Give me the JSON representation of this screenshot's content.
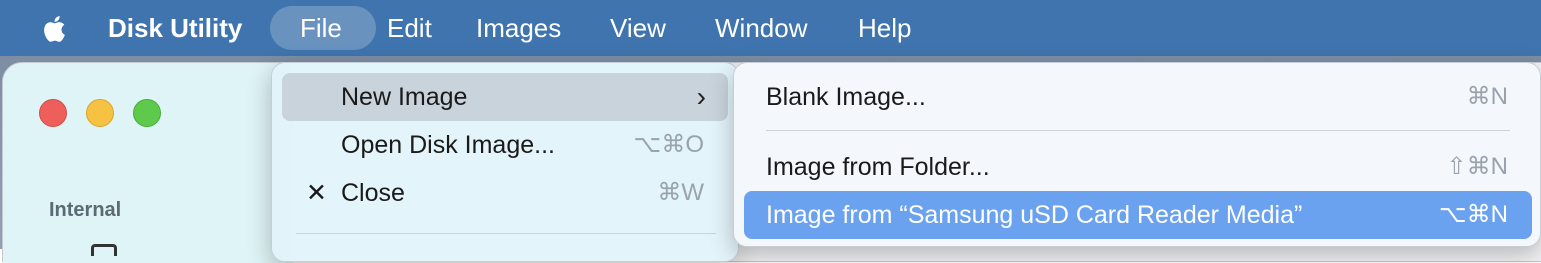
{
  "menubar": {
    "apple_icon": "apple-logo-icon",
    "app_name": "Disk Utility",
    "items": [
      "File",
      "Edit",
      "Images",
      "View",
      "Window",
      "Help"
    ],
    "active_item": "File"
  },
  "window": {
    "sidebar_section": "Internal"
  },
  "file_menu": {
    "new_image": {
      "label": "New Image",
      "arrow": "›"
    },
    "open_disk_image": {
      "label": "Open Disk Image...",
      "shortcut": "⌥⌘O"
    },
    "close": {
      "check": "✕",
      "label": "Close",
      "shortcut": "⌘W"
    }
  },
  "new_image_submenu": {
    "blank_image": {
      "label": "Blank Image...",
      "shortcut": "⌘N"
    },
    "image_from_folder": {
      "label": "Image from Folder...",
      "shortcut": "⇧⌘N"
    },
    "image_from_device": {
      "label": "Image from “Samsung uSD Card Reader Media”",
      "shortcut": "⌥⌘N"
    }
  },
  "colors": {
    "menubar_bg": "#3f74ae",
    "selection_blue": "#6ba2f0",
    "highlight_gray": "#c8d3dc"
  }
}
